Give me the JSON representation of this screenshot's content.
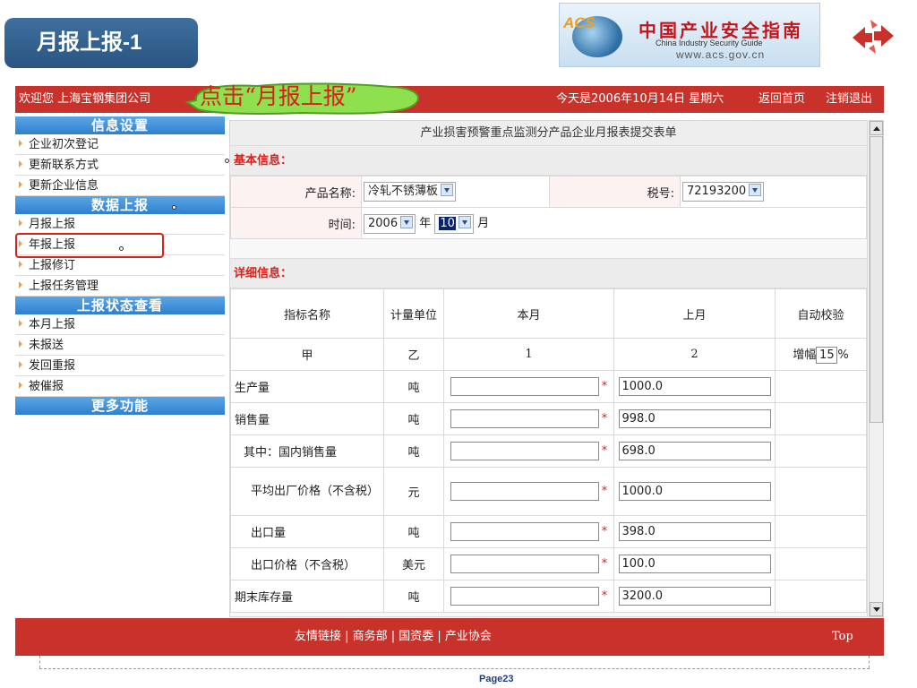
{
  "slide": {
    "title": "月报上报-1",
    "page": "Page23"
  },
  "logo": {
    "acs": "ACS",
    "cn": "中国产业安全指南",
    "en": "China Industry Security Guide",
    "url": "www.acs.gov.cn"
  },
  "topbar": {
    "welcome": "欢迎您 上海宝钢集团公司",
    "date": "今天是2006年10月14日  星期六",
    "home": "返回首页",
    "logout": "注销退出"
  },
  "callout": "点击“月报上报”",
  "sidebar": {
    "sections": [
      {
        "title": "信息设置",
        "items": [
          "企业初次登记",
          "更新联系方式",
          "更新企业信息"
        ]
      },
      {
        "title": "数据上报",
        "items": [
          "月报上报",
          "年报上报",
          "上报修订",
          "上报任务管理"
        ]
      },
      {
        "title": "上报状态查看",
        "items": [
          "本月上报",
          "未报送",
          "发回重报",
          "被催报"
        ]
      },
      {
        "title": "更多功能",
        "items": []
      }
    ]
  },
  "form": {
    "title": "产业损害预警重点监测分产品企业月报表提交表单",
    "basic_header": "基本信息：",
    "product_label": "产品名称:",
    "product_value": "冷轧不锈薄板",
    "tax_label": "税号:",
    "tax_value": "72193200",
    "time_label": "时间:",
    "year_value": "2006",
    "year_unit": "年",
    "month_value": "10",
    "month_unit": "月",
    "detail_header": "详细信息：",
    "columns": [
      "指标名称",
      "计量单位",
      "本月",
      "上月",
      "自动校验"
    ],
    "subheader": [
      "甲",
      "乙",
      "1",
      "2"
    ],
    "auto_check_prefix": "增幅",
    "auto_check_value": "15",
    "auto_check_unit": "%",
    "required_mark": "*",
    "rows": [
      {
        "name": "生产量",
        "unit": "吨",
        "prev": "1000.0"
      },
      {
        "name": "销售量",
        "unit": "吨",
        "prev": "998.0"
      },
      {
        "name": "其中：国内销售量",
        "unit": "吨",
        "prev": "698.0"
      },
      {
        "name": "平均出厂价格（不含税）",
        "unit": "元",
        "prev": "1000.0"
      },
      {
        "name": "出口量",
        "unit": "吨",
        "prev": "398.0"
      },
      {
        "name": "出口价格（不含税）",
        "unit": "美元",
        "prev": "100.0"
      },
      {
        "name": "期末库存量",
        "unit": "吨",
        "prev": "3200.0"
      }
    ]
  },
  "footer": {
    "links": "友情链接 | 商务部 | 国资委 | 产业协会",
    "top": "Top"
  }
}
